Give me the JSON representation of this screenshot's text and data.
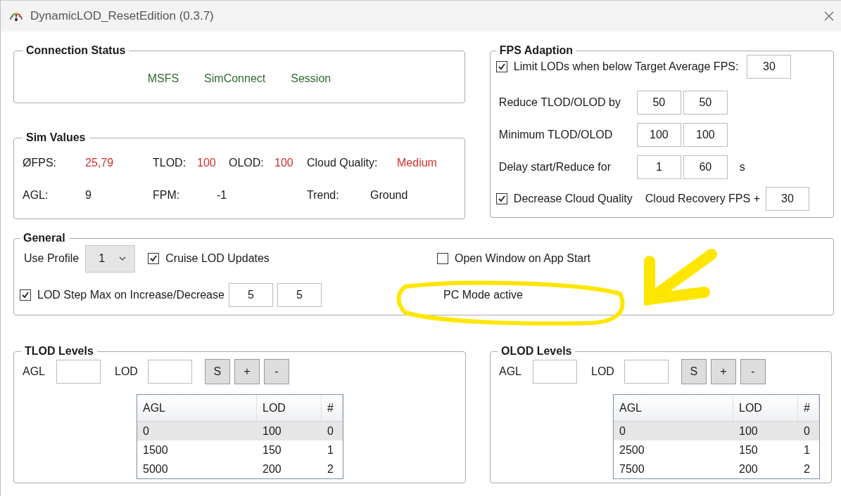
{
  "window": {
    "title": "DynamicLOD_ResetEdition (0.3.7)"
  },
  "connection_status": {
    "title": "Connection Status",
    "items": [
      {
        "label": "MSFS",
        "connected": true
      },
      {
        "label": "SimConnect",
        "connected": true
      },
      {
        "label": "Session",
        "connected": true
      }
    ]
  },
  "sim_values": {
    "title": "Sim Values",
    "rows": [
      [
        {
          "label": "ØFPS:",
          "value": "25,79",
          "alert": true
        },
        {
          "label": "TLOD:",
          "value": "100",
          "alert": true
        },
        {
          "label": "OLOD:",
          "value": "100",
          "alert": true
        },
        {
          "label": "Cloud Quality:",
          "value": "Medium",
          "alert": true
        }
      ],
      [
        {
          "label": "AGL:",
          "value": "9",
          "alert": false
        },
        {
          "label": "FPM:",
          "value": "-1",
          "alert": false
        },
        "",
        {
          "label": "Trend:",
          "value": "Ground",
          "alert": false
        }
      ]
    ]
  },
  "fps_adaption": {
    "title": "FPS Adaption",
    "limit": {
      "label": "Limit LODs when below Target Average FPS:",
      "checked": true,
      "value": "30"
    },
    "rows": [
      {
        "label": "Reduce TLOD/OLOD by",
        "values": [
          "50",
          "50"
        ]
      },
      {
        "label": "Minimum TLOD/OLOD",
        "values": [
          "100",
          "100"
        ]
      },
      {
        "label": "Delay start/Reduce for",
        "values": [
          "1",
          "60"
        ],
        "unit": "s"
      }
    ],
    "cloud": {
      "label": "Decrease Cloud Quality",
      "checked": true,
      "recovery_label": "Cloud Recovery FPS +",
      "value": "30"
    }
  },
  "general": {
    "title": "General",
    "profile_label": "Use Profile",
    "profile": "1",
    "cruise": {
      "label": "Cruise LOD Updates",
      "checked": true
    },
    "open_window": {
      "label": "Open Window on App Start",
      "checked": false
    },
    "step_max": {
      "label": "LOD Step Max on Increase/Decrease",
      "checked": true,
      "values": [
        "5",
        "5"
      ]
    },
    "mode_text": "PC Mode active"
  },
  "level_panels": [
    {
      "title": "TLOD Levels",
      "agl_label": "AGL",
      "lod_label": "LOD",
      "buttons": [
        "S",
        "+",
        "-"
      ],
      "table": {
        "columns": [
          "AGL",
          "LOD",
          "#"
        ],
        "rows": [
          {
            "cells": [
              "0",
              "100",
              "0"
            ],
            "selected": true
          },
          {
            "cells": [
              "1500",
              "150",
              "1"
            ],
            "selected": false
          },
          {
            "cells": [
              "5000",
              "200",
              "2"
            ],
            "selected": false
          }
        ]
      }
    },
    {
      "title": "OLOD Levels",
      "agl_label": "AGL",
      "lod_label": "LOD",
      "buttons": [
        "S",
        "+",
        "-"
      ],
      "table": {
        "columns": [
          "AGL",
          "LOD",
          "#"
        ],
        "rows": [
          {
            "cells": [
              "0",
              "100",
              "0"
            ],
            "selected": true
          },
          {
            "cells": [
              "2500",
              "150",
              "1"
            ],
            "selected": false
          },
          {
            "cells": [
              "7500",
              "200",
              "2"
            ],
            "selected": false
          }
        ]
      }
    }
  ]
}
